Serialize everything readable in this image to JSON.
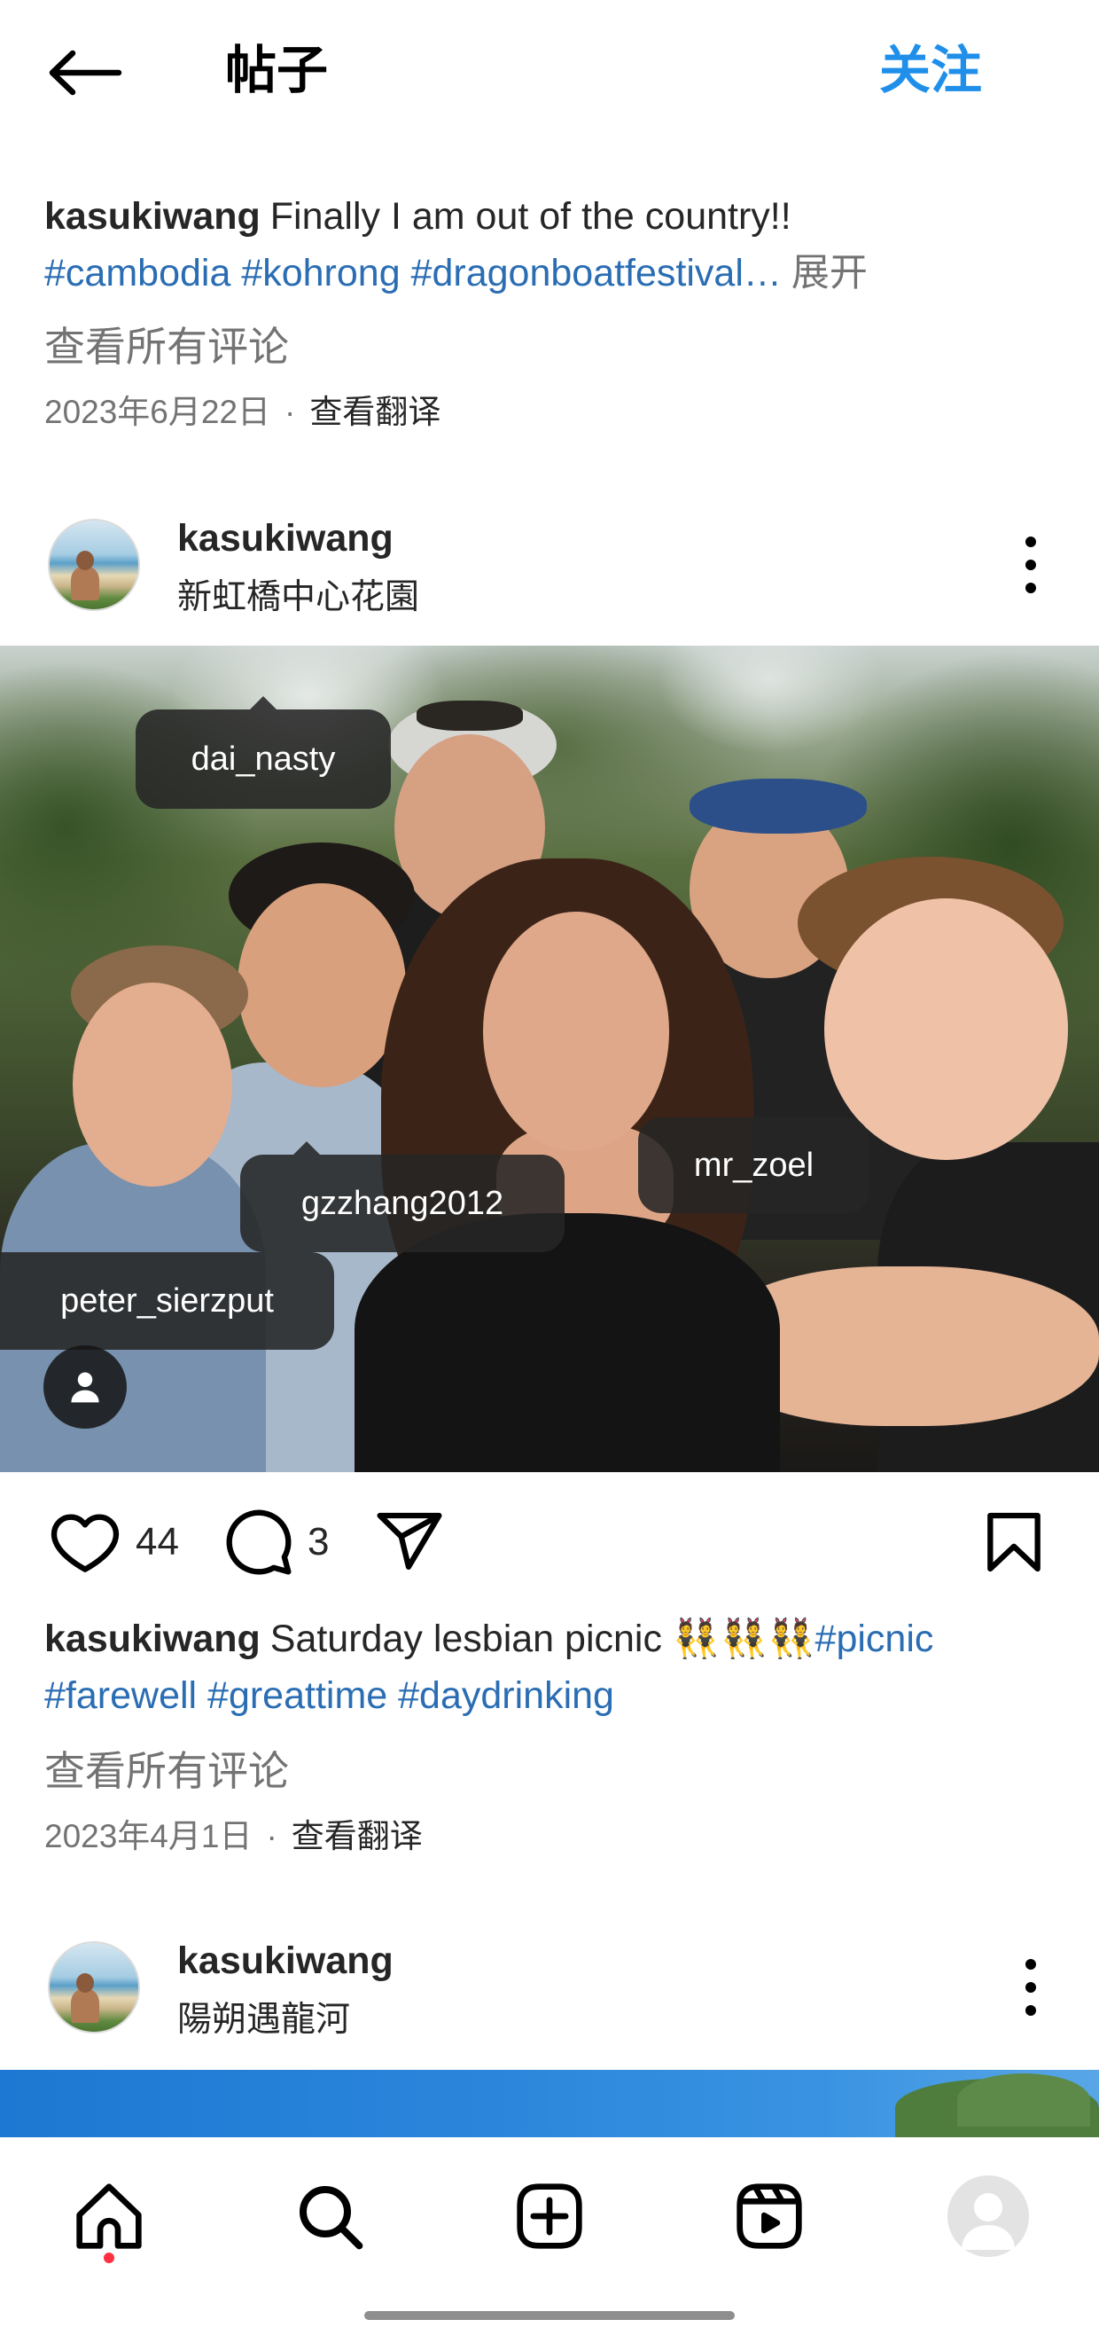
{
  "colors": {
    "text": "#262626",
    "secondary": "#737373",
    "link": "#2a6db3",
    "accent": "#1f8fea",
    "tag_background": "rgba(38,38,38,0.88)",
    "notification_dot": "#ff2f40"
  },
  "header": {
    "title": "帖子",
    "follow_label": "关注",
    "back_icon": "arrow-left-icon"
  },
  "previous_post": {
    "caption": {
      "username": "kasukiwang",
      "text": "Finally I am out of the country!!",
      "hashtags": "#cambodia #kohrong #dragonboatfestival…",
      "more_label": "展开"
    },
    "view_comments_label": "查看所有评论",
    "date": "2023年6月22日",
    "separator": "·",
    "translate_label": "查看翻译"
  },
  "post": {
    "username": "kasukiwang",
    "location": "新虹橋中心花園",
    "more_icon": "more-vertical-icon",
    "tags": [
      {
        "name": "dai_nasty"
      },
      {
        "name": "gzzhang2012"
      },
      {
        "name": "mr_zoel"
      },
      {
        "name": "peter_sierzput"
      }
    ],
    "tagged_people_icon": "person-icon",
    "likes_count": "44",
    "comments_count": "3",
    "actions": {
      "like_icon": "heart-icon",
      "comment_icon": "comment-icon",
      "share_icon": "send-icon",
      "save_icon": "bookmark-icon"
    },
    "caption": {
      "username": "kasukiwang",
      "text": "Saturday lesbian picnic 👯👯👯",
      "hashtag_inline": "#picnic",
      "hashtags": "#farewell #greattime #daydrinking"
    },
    "view_comments_label": "查看所有评论",
    "date": "2023年4月1日",
    "separator": "·",
    "translate_label": "查看翻译"
  },
  "next_post": {
    "username": "kasukiwang",
    "location": "陽朔遇龍河",
    "more_icon": "more-vertical-icon"
  },
  "bottom_nav": {
    "items": [
      {
        "icon": "home-icon",
        "active": true,
        "has_notification": true
      },
      {
        "icon": "search-icon",
        "active": false
      },
      {
        "icon": "plus-square-icon",
        "active": false
      },
      {
        "icon": "reels-icon",
        "active": false
      },
      {
        "icon": "profile-avatar-icon",
        "active": false
      }
    ]
  }
}
